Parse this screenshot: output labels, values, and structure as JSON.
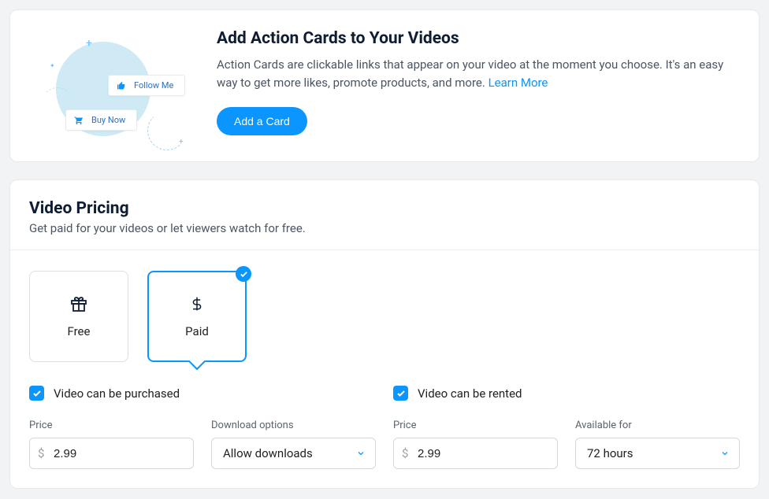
{
  "action_cards": {
    "title": "Add Action Cards to Your Videos",
    "description": "Action Cards are clickable links that appear on your video at the moment you choose. It's an easy way to get more likes, promote products, and more. ",
    "learn_more": "Learn More",
    "add_button": "Add a Card",
    "illus_follow": "Follow Me",
    "illus_buy": "Buy Now"
  },
  "pricing": {
    "title": "Video Pricing",
    "subtitle": "Get paid for your videos or let viewers watch for free.",
    "options": {
      "free": "Free",
      "paid": "Paid"
    },
    "purchase": {
      "checkbox_label": "Video can be purchased",
      "price_label": "Price",
      "price_value": "2.99",
      "download_label": "Download options",
      "download_value": "Allow downloads"
    },
    "rent": {
      "checkbox_label": "Video can be rented",
      "price_label": "Price",
      "price_value": "2.99",
      "available_label": "Available for",
      "available_value": "72 hours"
    }
  }
}
